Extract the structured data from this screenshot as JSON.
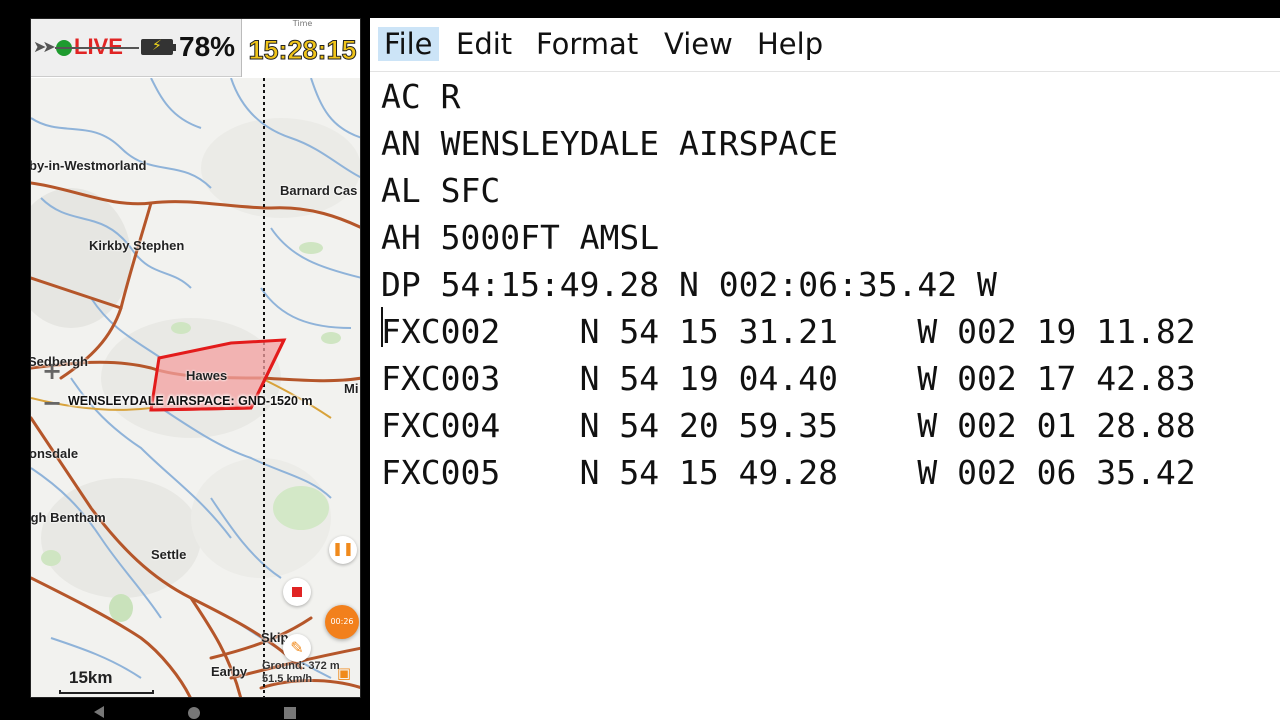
{
  "phone": {
    "status": {
      "live_label": "LIVE",
      "battery_percent": "78%",
      "time_label": "Time",
      "time_value": "15:28:15"
    },
    "map": {
      "towns": {
        "appleby": "by-in-Westmorland",
        "barnard": "Barnard Cas",
        "kirkby_stephen": "Kirkby Stephen",
        "sedbergh": "Sedbergh",
        "hawes": "Hawes",
        "middleham": "Mi",
        "lonsdale": "onsdale",
        "high_bentham": "igh Bentham",
        "settle": "Settle",
        "skipton": "Skip",
        "earby": "Earby"
      },
      "airspace_label": "WENSLEYDALE AIRSPACE: GND-1520 m",
      "scale": "15km",
      "timer": "00:26",
      "ground_line1": "Ground: 372 m",
      "ground_line2": "51.5 km/h",
      "colors": {
        "airspace_outline": "#e31b1b",
        "airspace_fill": "#f4a0a0",
        "road": "#b5562a",
        "river": "#8fb3d9",
        "accent": "#f2801c"
      }
    }
  },
  "notepad": {
    "menu": [
      "File",
      "Edit",
      "Format",
      "View",
      "Help"
    ],
    "lines": [
      "AC R",
      "AN WENSLEYDALE AIRSPACE",
      "AL SFC",
      "AH 5000FT AMSL",
      "DP 54:15:49.28 N 002:06:35.42 W",
      "FXC002    N 54 15 31.21    W 002 19 11.82",
      "FXC003    N 54 19 04.40    W 002 17 42.83",
      "FXC004    N 54 20 59.35    W 002 01 28.88",
      "FXC005    N 54 15 49.28    W 002 06 35.42"
    ]
  }
}
